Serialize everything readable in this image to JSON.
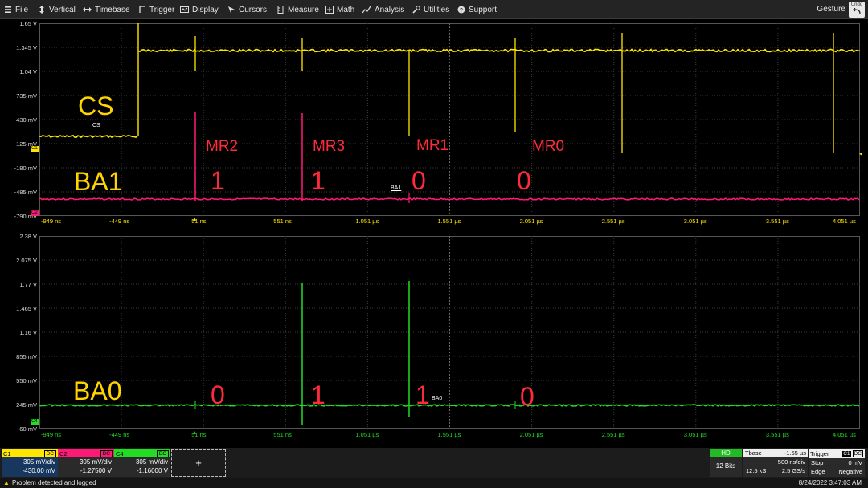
{
  "menu": {
    "items": [
      {
        "label": "File",
        "icon": "menu-icon"
      },
      {
        "label": "Vertical",
        "icon": "vertical-icon"
      },
      {
        "label": "Timebase",
        "icon": "timebase-icon"
      },
      {
        "label": "Trigger",
        "icon": "trigger-icon"
      },
      {
        "label": "Display",
        "icon": "display-icon"
      },
      {
        "label": "Cursors",
        "icon": "cursors-icon"
      },
      {
        "label": "Measure",
        "icon": "measure-icon"
      },
      {
        "label": "Math",
        "icon": "math-icon"
      },
      {
        "label": "Analysis",
        "icon": "analysis-icon"
      },
      {
        "label": "Utilities",
        "icon": "utilities-icon"
      },
      {
        "label": "Support",
        "icon": "support-icon"
      }
    ],
    "gesture": "Gesture",
    "undo": "Undo"
  },
  "colors": {
    "c1": "#ffe600",
    "c2": "#ff1a75",
    "c4": "#22dd22",
    "annotation": "#ff2a3a",
    "channel_label": "#ffd400"
  },
  "upper_grid": {
    "y_labels": [
      "1.65 V",
      "1.345 V",
      "1.04 V",
      "735 mV",
      "430 mV",
      "125 mV",
      "-180 mV",
      "-485 mV",
      "-790 mV"
    ],
    "x_labels": [
      "-949 ns",
      "-449 ns",
      "51 ns",
      "551 ns",
      "1.051 µs",
      "1.551 µs",
      "2.051 µs",
      "2.551 µs",
      "3.051 µs",
      "3.551 µs",
      "4.051 µs"
    ],
    "c1_marker": "C1",
    "c2_marker": "C2",
    "cs_tag": "CS",
    "ba1_tag": "BA1",
    "signal_label_cs": "CS",
    "signal_label_ba1": "BA1",
    "mr_labels": [
      "MR2",
      "MR3",
      "MR1",
      "MR0"
    ],
    "ba1_bits": [
      "1",
      "1",
      "0",
      "0"
    ]
  },
  "lower_grid": {
    "y_labels": [
      "2.38 V",
      "2.075 V",
      "1.77 V",
      "1.465 V",
      "1.16 V",
      "855 mV",
      "550 mV",
      "245 mV",
      "-60 mV"
    ],
    "x_labels": [
      "-949 ns",
      "-449 ns",
      "51 ns",
      "551 ns",
      "1.051 µs",
      "1.551 µs",
      "2.051 µs",
      "2.551 µs",
      "3.051 µs",
      "3.551 µs",
      "4.051 µs"
    ],
    "c4_marker": "C4",
    "ba0_tag": "BA0",
    "signal_label_ba0": "BA0",
    "ba0_bits": [
      "0",
      "1",
      "1",
      "0"
    ]
  },
  "channels": [
    {
      "name": "C1",
      "coupling": "DC",
      "scale": "305 mV/div",
      "offset": "-430.00 mV"
    },
    {
      "name": "C2",
      "coupling": "DC",
      "scale": "305 mV/div",
      "offset": "-1.27500 V"
    },
    {
      "name": "C4",
      "coupling": "DC",
      "scale": "305 mV/div",
      "offset": "-1.16000 V"
    }
  ],
  "add_channel": "+",
  "hd": {
    "badge": "HD",
    "bits": "12 Bits"
  },
  "timebase": {
    "label": "Tbase",
    "delay": "-1.55 µs",
    "per_div": "500 ns/div",
    "samples": "12.5 kS",
    "rate": "2.5 GS/s"
  },
  "trigger": {
    "label": "Trigger",
    "source": "C1",
    "coupling": "DC",
    "mode": "Stop",
    "level": "0 mV",
    "type": "Edge",
    "slope": "Negative"
  },
  "status": {
    "message": "Problem detected and logged",
    "datetime": "8/24/2022 3:47:03 AM"
  }
}
